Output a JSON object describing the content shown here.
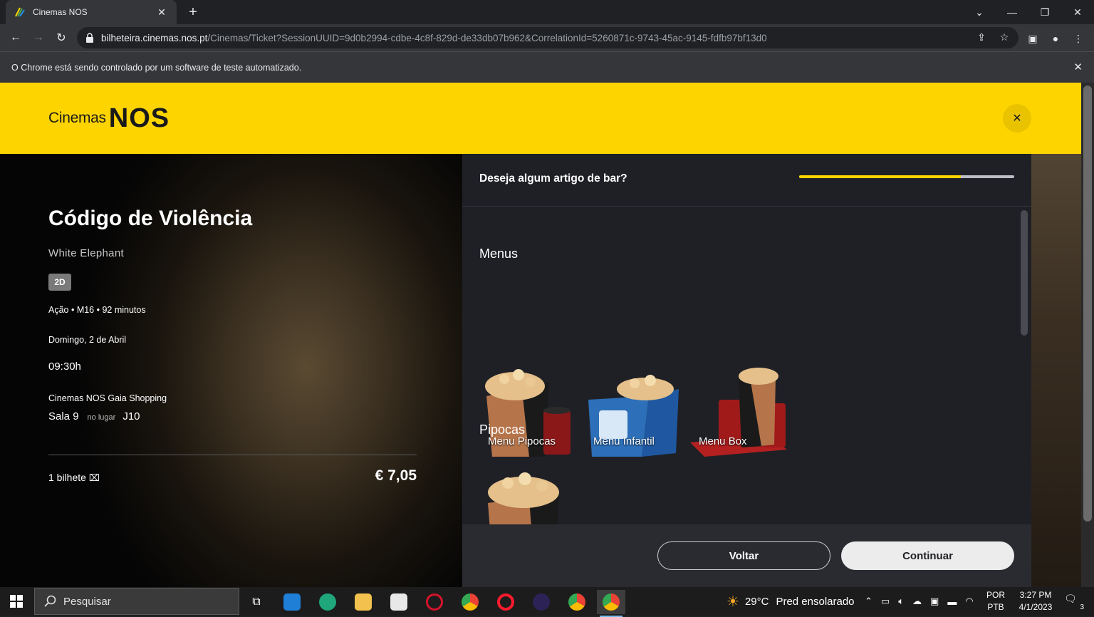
{
  "browser": {
    "tab_title": "Cinemas NOS",
    "url_host": "bilheteira.cinemas.nos.pt",
    "url_path": "/Cinemas/Ticket?SessionUUID=9d0b2994-cdbe-4c8f-829d-de33db07b962&CorrelationId=5260871c-9743-45ac-9145-fdfb97bf13d0",
    "infobar_message": "O Chrome está sendo controlado por um software de teste automatizado."
  },
  "header": {
    "logo_text": "Cinemas",
    "logo_brand": "NOS"
  },
  "movie": {
    "title": "Código de Violência",
    "original_title": "White Elephant",
    "format": "2D",
    "genre_line": "Ação • M16 • 92 minutos",
    "date": "Domingo, 2 de Abril",
    "time": "09:30h",
    "cinema": "Cinemas NOS Gaia Shopping",
    "room": "Sala 9",
    "seat_label": "no lugar",
    "seat": "J10",
    "tickets": "1 bilhete",
    "price": "€ 7,05"
  },
  "bar": {
    "question": "Deseja algum artigo de bar?",
    "progress": 0.75,
    "sections": [
      {
        "title": "Menus",
        "items": [
          "Menu Pipocas",
          "Menu Infantil",
          "Menu Box"
        ]
      },
      {
        "title": "Pipocas",
        "items": [
          ""
        ]
      }
    ],
    "back_label": "Voltar",
    "continue_label": "Continuar"
  },
  "taskbar": {
    "search_label": "Pesquisar",
    "weather_temp": "29°C",
    "weather_desc": "Pred ensolarado",
    "lang_1": "POR",
    "lang_2": "PTB",
    "time": "3:27 PM",
    "date": "4/1/2023",
    "notification_count": "3"
  },
  "colors": {
    "brand_yellow": "#fed400",
    "panel": "#1f2026"
  }
}
